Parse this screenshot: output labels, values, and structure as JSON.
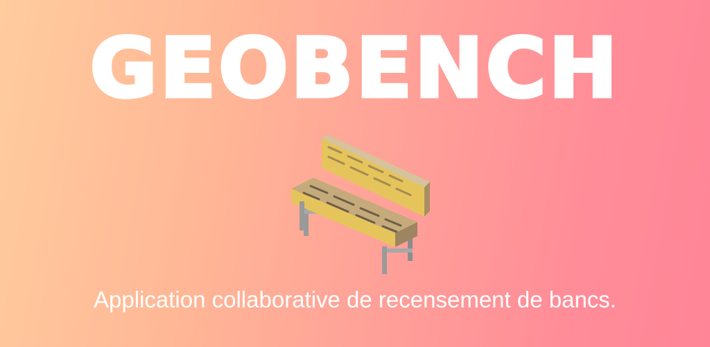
{
  "banner": {
    "title": "GEOBENCH",
    "subtitle": "Application collaborative de recensement de bancs.",
    "illustration_icon": "park-bench-icon"
  },
  "colors": {
    "gradient_start": "#ffcc9e",
    "gradient_end": "#ff8597",
    "text": "#ffffff",
    "wood_top": "#e8cf73",
    "wood_side": "#d9b443",
    "wood_back": "#c2a36c",
    "frame": "#9a9a9a"
  }
}
